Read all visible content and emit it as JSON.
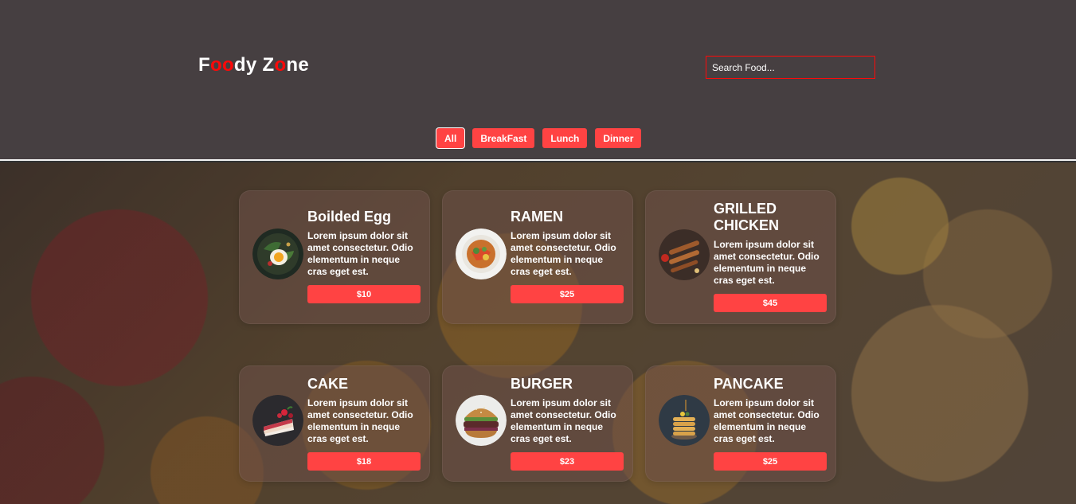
{
  "header": {
    "logo": [
      "F",
      "o",
      "o",
      "dy Z",
      "o",
      "ne"
    ],
    "search_placeholder": "Search Food..."
  },
  "filters": [
    "All",
    "BreakFast",
    "Lunch",
    "Dinner"
  ],
  "foods": [
    {
      "name": "Boilded Egg",
      "description": "Lorem ipsum dolor sit amet consectetur. Odio elementum in neque cras eget est.",
      "price": "$10",
      "icon": "boiled-egg-icon"
    },
    {
      "name": "RAMEN",
      "description": "Lorem ipsum dolor sit amet consectetur. Odio elementum in neque cras eget est.",
      "price": "$25",
      "icon": "ramen-icon"
    },
    {
      "name": "GRILLED CHICKEN",
      "description": "Lorem ipsum dolor sit amet consectetur. Odio elementum in neque cras eget est.",
      "price": "$45",
      "icon": "grilled-chicken-icon"
    },
    {
      "name": "CAKE",
      "description": "Lorem ipsum dolor sit amet consectetur. Odio elementum in neque cras eget est.",
      "price": "$18",
      "icon": "cake-icon"
    },
    {
      "name": "BURGER",
      "description": "Lorem ipsum dolor sit amet consectetur. Odio elementum in neque cras eget est.",
      "price": "$23",
      "icon": "burger-icon"
    },
    {
      "name": "PANCAKE",
      "description": "Lorem ipsum dolor sit amet consectetur. Odio elementum in neque cras eget est.",
      "price": "$25",
      "icon": "pancake-icon"
    }
  ],
  "colors": {
    "accent": "#ff4343",
    "logo_highlight": "#ff0909",
    "header_bg": "#463f41"
  }
}
